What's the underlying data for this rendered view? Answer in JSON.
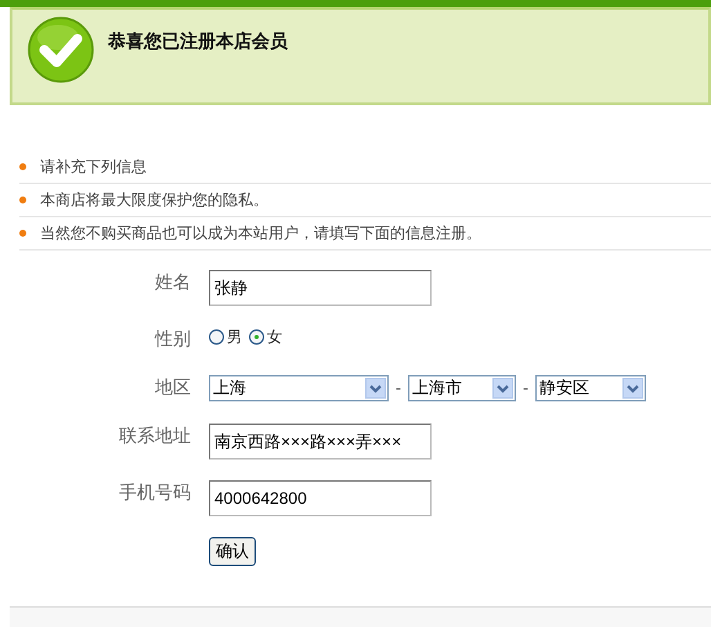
{
  "banner": {
    "title": "恭喜您已注册本店会员"
  },
  "notices": [
    "请补充下列信息",
    "本商店将最大限度保护您的隐私。",
    "当然您不购买商品也可以成为本站用户，请填写下面的信息注册。"
  ],
  "form": {
    "fields": [
      {
        "kind": "text",
        "label": "姓名",
        "value": "张静"
      },
      {
        "kind": "radio",
        "label": "性别",
        "options": [
          {
            "label": "男",
            "selected": false
          },
          {
            "label": "女",
            "selected": true
          }
        ]
      },
      {
        "kind": "selects",
        "label": "地区",
        "parts": [
          {
            "kind": "select",
            "value": "上海"
          },
          {
            "kind": "sep",
            "text": "-"
          },
          {
            "kind": "select",
            "value": "上海市"
          },
          {
            "kind": "sep",
            "text": "-"
          },
          {
            "kind": "select",
            "value": "静安区"
          }
        ]
      },
      {
        "kind": "text",
        "label": "联系地址",
        "value": "南京西路×××路×××弄×××"
      },
      {
        "kind": "text",
        "label": "手机号码",
        "value": "4000642800"
      }
    ],
    "submit": "确认"
  }
}
